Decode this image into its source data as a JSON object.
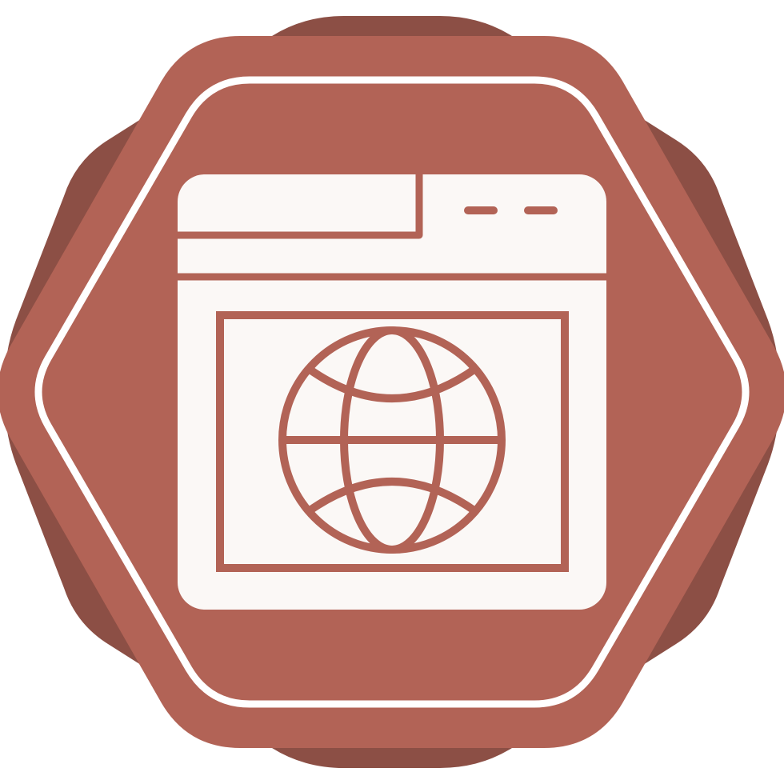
{
  "icon": {
    "subject": "web-browser-globe-icon",
    "badge_shape": "hexagon-over-octagon-seal",
    "colors": {
      "background": "#ffffff",
      "seal_dark": "#8c4f45",
      "hexagon": "#b26356",
      "outline": "#ffffff",
      "window": "#fbf8f6",
      "detail": "#b26356"
    }
  }
}
